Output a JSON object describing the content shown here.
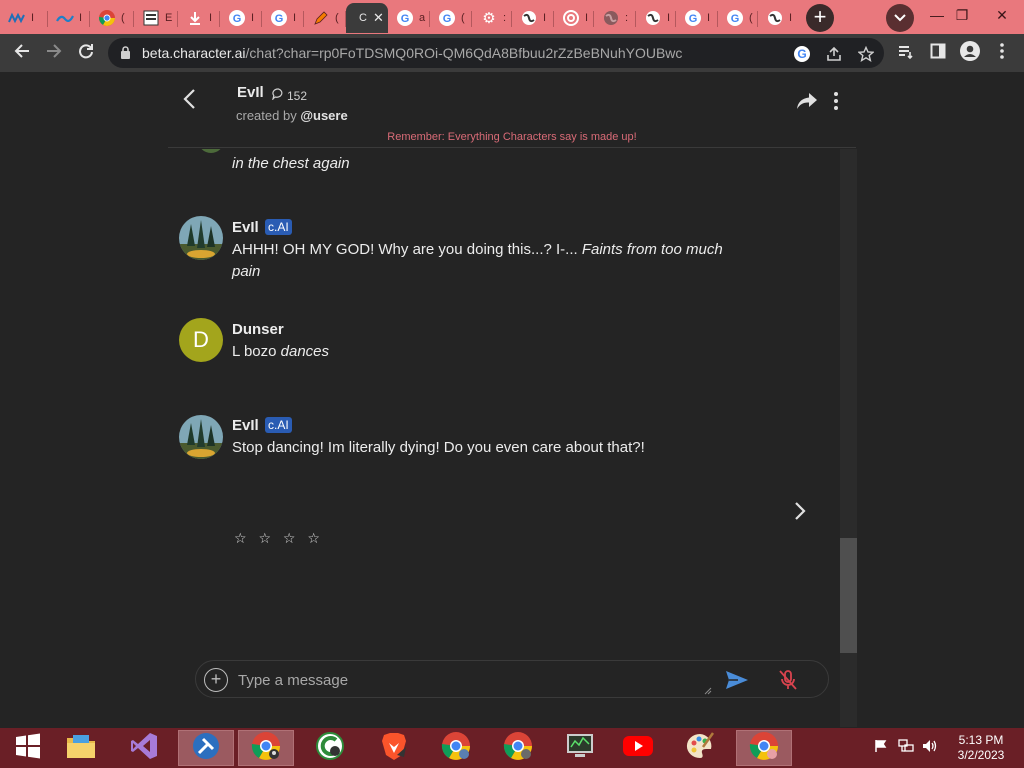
{
  "browser": {
    "active_tab_title": "C",
    "new_tab_label": "+",
    "url_host": "beta.character.ai",
    "url_path": "/chat?char=rp0FoTDSMQ0ROi-QM6QdA8Bfbuu2rZzBeBNuhYOUBwc"
  },
  "chat_header": {
    "character_name": "EvIl",
    "interaction_count": "152",
    "created_by_prefix": "created by",
    "creator_handle": "@usere",
    "disclaimer": "Remember: Everything Characters say is made up!"
  },
  "messages": [
    {
      "sender": "",
      "text_italic": "in the chest again"
    },
    {
      "sender": "EvIl",
      "badge": "c.AI",
      "text": "AHHH! OH MY GOD! Why are you doing this...? I-... ",
      "text_italic": "Faints from too much",
      "text_italic_2": "pain"
    },
    {
      "sender": "Dunser",
      "avatar_letter": "D",
      "text": "L bozo ",
      "text_italic": "dances"
    },
    {
      "sender": "EvIl",
      "badge": "c.AI",
      "text": "Stop dancing! Im literally dying! Do you even care about that?!"
    }
  ],
  "rating_stars": "☆ ☆ ☆ ☆",
  "composer": {
    "placeholder": "Type a message"
  },
  "taskbar": {
    "time": "5:13 PM",
    "date": "3/2/2023"
  },
  "colors": {
    "tabstrip": "#e9787d",
    "taskbar": "#6a1f26",
    "badge": "#2a5cb3",
    "disclaimer": "#d96b77",
    "dunser_avatar": "#a3a51c",
    "send_icon": "#4a8cd8",
    "mic_off_icon": "#d9434e"
  }
}
